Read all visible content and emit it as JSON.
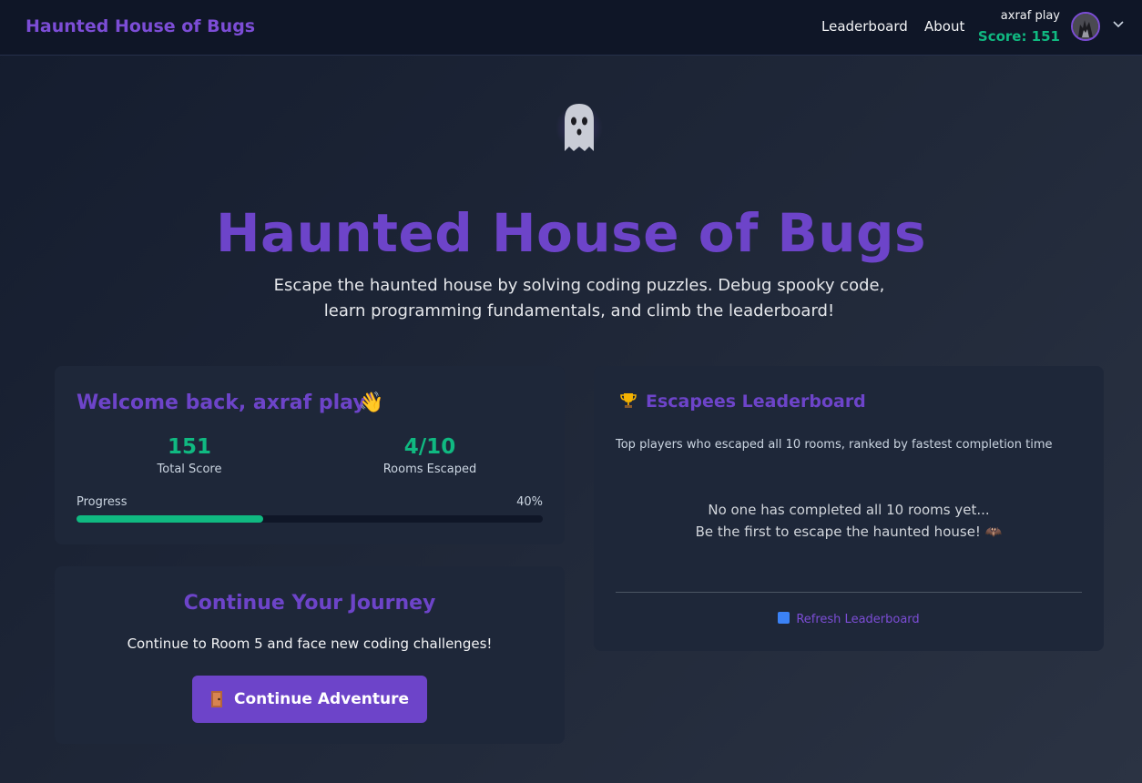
{
  "nav": {
    "brand": "Haunted House of Bugs",
    "links": [
      "Leaderboard",
      "About"
    ],
    "user_name": "axraf play",
    "user_score": "Score: 151"
  },
  "hero": {
    "title": "Haunted House of Bugs",
    "subtitle_line1": "Escape the haunted house by solving coding puzzles. Debug spooky code,",
    "subtitle_line2": "learn programming fundamentals, and climb the leaderboard!"
  },
  "welcome": {
    "title": "Welcome back, axraf play!",
    "wave": "👋",
    "stats": [
      {
        "value": "151",
        "label": "Total Score"
      },
      {
        "value": "4/10",
        "label": "Rooms Escaped"
      }
    ],
    "progress_label": "Progress",
    "progress_text": "40%",
    "progress_fraction": 0.4
  },
  "journey": {
    "title": "Continue Your Journey",
    "text": "Continue to Room 5 and face new coding challenges!",
    "button": "Continue Adventure"
  },
  "leaderboard": {
    "title": "Escapees Leaderboard",
    "subtitle": "Top players who escaped all 10 rooms, ranked by fastest completion time",
    "empty_line1": "No one has completed all 10 rooms yet...",
    "empty_line2": "Be the first to escape the haunted house! 🦇",
    "refresh": "Refresh Leaderboard"
  },
  "icons": {
    "ghost": "ghost-icon",
    "trophy": "trophy-icon",
    "door": "door-icon",
    "refresh": "refresh-icon",
    "chevron": "chevron-down-icon"
  },
  "colors": {
    "accent": "#6d44c9",
    "success": "#10b981"
  }
}
